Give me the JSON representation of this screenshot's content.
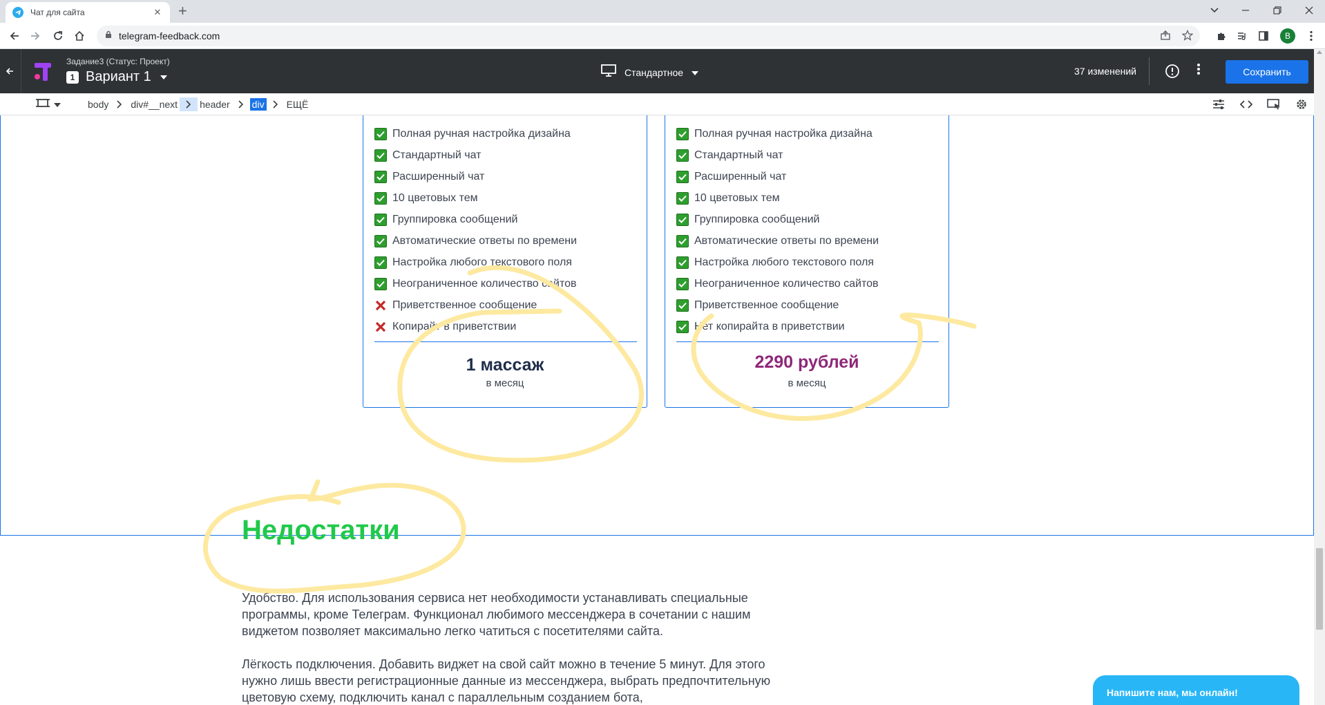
{
  "browser": {
    "tab_title": "Чат для сайта",
    "url": "telegram-feedback.com",
    "profile_initial": "B"
  },
  "editor": {
    "task_title": "Задание3 (Статус: Проект)",
    "variant_number": "1",
    "variant_label": "Вариант 1",
    "device_label": "Стандартное",
    "changes_count": "37 изменений",
    "save_label": "Сохранить"
  },
  "breadcrumbs": [
    "body",
    "div#__next",
    "header",
    "div",
    "ЕЩЁ"
  ],
  "plans": [
    {
      "features": [
        {
          "text": "Полная ручная настройка дизайна",
          "included": true
        },
        {
          "text": "Стандартный чат",
          "included": true
        },
        {
          "text": "Расширенный чат",
          "included": true
        },
        {
          "text": "10 цветовых тем",
          "included": true
        },
        {
          "text": "Группировка сообщений",
          "included": true
        },
        {
          "text": "Автоматические ответы по времени",
          "included": true
        },
        {
          "text": "Настройка любого текстового поля",
          "included": true
        },
        {
          "text": "Неограниченное количество сайтов",
          "included": true
        },
        {
          "text": "Приветственное сообщение",
          "included": false
        },
        {
          "text": "Копирайт в приветствии",
          "included": false
        }
      ],
      "price": "1 массаж",
      "period": "в месяц"
    },
    {
      "features": [
        {
          "text": "Полная ручная настройка дизайна",
          "included": true
        },
        {
          "text": "Стандартный чат",
          "included": true
        },
        {
          "text": "Расширенный чат",
          "included": true
        },
        {
          "text": "10 цветовых тем",
          "included": true
        },
        {
          "text": "Группировка сообщений",
          "included": true
        },
        {
          "text": "Автоматические ответы по времени",
          "included": true
        },
        {
          "text": "Настройка любого текстового поля",
          "included": true
        },
        {
          "text": "Неограниченное количество сайтов",
          "included": true
        },
        {
          "text": "Приветственное сообщение",
          "included": true
        },
        {
          "text": "Нет копирайта в приветствии",
          "included": true
        }
      ],
      "price": "2290 рублей",
      "period": "в месяц"
    }
  ],
  "section": {
    "heading": "Недостатки",
    "paragraphs": [
      "Удобство. Для использования сервиса нет необходимости устанавливать специальные программы, кроме Телеграм. Функционал любимого мессенджера в сочетании с нашим виджетом позволяет максимально легко чатиться с посетителями сайта.",
      "Лёгкость подключения. Добавить виджет на свой сайт можно в течение 5 минут. Для этого нужно лишь ввести регистрационные данные из мессенджера, выбрать предпочтительную цветовую схему, подключить канал с параллельным созданием бота,"
    ]
  },
  "chat_widget": {
    "label": "Напишите нам, мы онлайн!"
  },
  "colors": {
    "accent_blue": "#1a73e8",
    "heading_green": "#20c94a",
    "price_purple": "#8e2878",
    "annotation_yellow": "#fde9a0",
    "widget_blue": "#29b6f6"
  }
}
